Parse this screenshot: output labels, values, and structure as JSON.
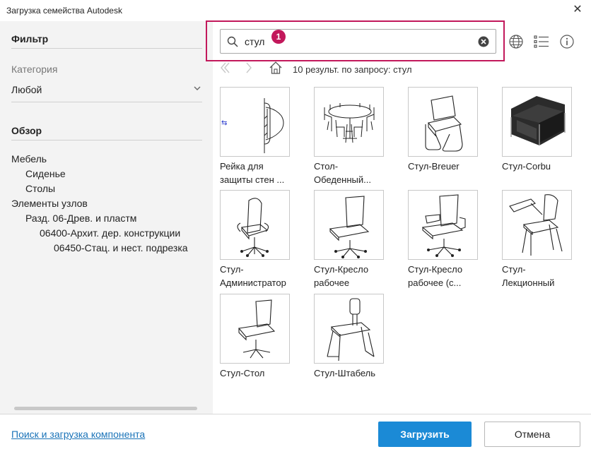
{
  "window": {
    "title": "Загрузка семейства Autodesk",
    "close": "✕"
  },
  "sidebar": {
    "filter_heading": "Фильтр",
    "category_label": "Категория",
    "category_value": "Любой",
    "browse_heading": "Обзор",
    "tree": [
      "Мебель",
      "Сиденье",
      "Столы",
      "Элементы узлов",
      "Разд. 06-Древ. и пластм",
      "06400-Архит. дер. конструкции",
      "06450-Стац. и нест. подрезка"
    ]
  },
  "search": {
    "value": "стул",
    "badge": "1"
  },
  "toolbar": {
    "icons": [
      "globe-icon",
      "list-view-icon",
      "info-icon"
    ]
  },
  "breadcrumb": {
    "result_text": "10 результ. по запросу: стул"
  },
  "results": [
    {
      "caption": "Рейка для защиты стен ..."
    },
    {
      "caption": "Стол-Обеденный..."
    },
    {
      "caption": "Стул-Breuer"
    },
    {
      "caption": "Стул-Corbu"
    },
    {
      "caption": "Стул-Администратор"
    },
    {
      "caption": "Стул-Кресло рабочее"
    },
    {
      "caption": "Стул-Кресло рабочее (с..."
    },
    {
      "caption": "Стул-Лекционный"
    },
    {
      "caption": "Стул-Стол"
    },
    {
      "caption": "Стул-Штабель"
    }
  ],
  "footer": {
    "link": "Поиск и загрузка компонента",
    "load_button": "Загрузить",
    "cancel_button": "Отмена"
  },
  "colors": {
    "accent": "#1b8ad6",
    "highlight": "#c2185b",
    "link": "#1a73b8"
  }
}
